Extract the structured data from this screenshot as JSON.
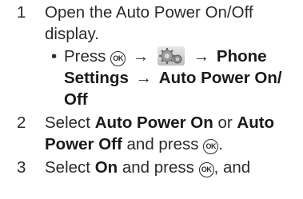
{
  "steps": [
    {
      "number": "1",
      "line1": "Open the Auto Power On/Off",
      "line2": "display."
    },
    {
      "number": "2"
    },
    {
      "number": "3"
    }
  ],
  "bullet": {
    "symbol": "•",
    "press": "Press",
    "ok_key": "OK",
    "arrow": "→",
    "settings_icon": "gear-settings-icon",
    "phone_settings": "Phone",
    "settings": "Settings",
    "auto_power": "Auto Power On/",
    "off": "Off"
  },
  "step2": {
    "select": "Select",
    "auto_power_on": "Auto Power On",
    "or": "or",
    "auto": "Auto",
    "power_off": "Power Off",
    "and_press": "and press",
    "period": "."
  },
  "step3": {
    "select": "Select",
    "on": "On",
    "and_press": "and press",
    "and": ", and"
  }
}
